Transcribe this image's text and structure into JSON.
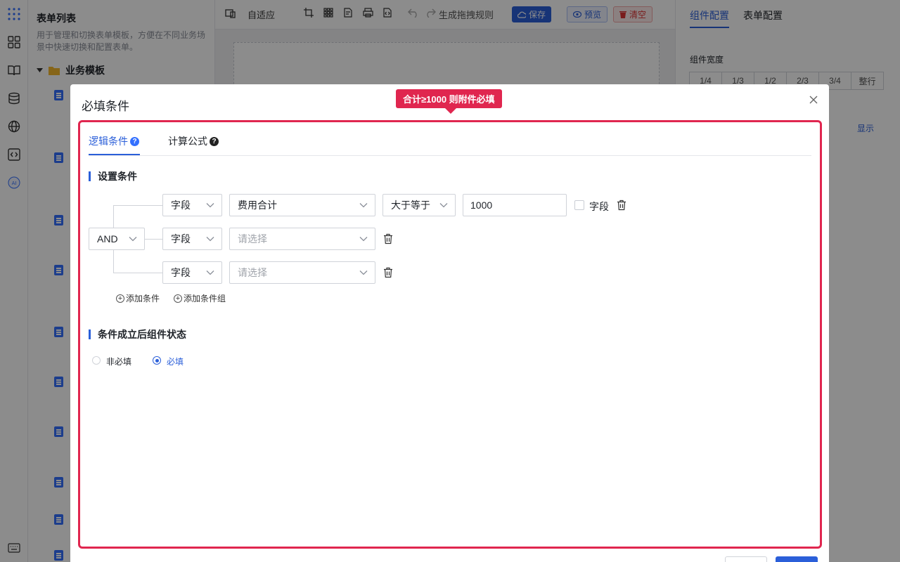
{
  "sidebar": {
    "title": "表单列表",
    "description": "用于管理和切换表单模板，方便在不同业务场景中快速切换和配置表单。",
    "folder": "业务模板"
  },
  "toolbar": {
    "adaptive": "自适应",
    "generate_rule": "生成拖拽规则",
    "save": "保存",
    "preview": "预览",
    "clear": "清空"
  },
  "right_panel": {
    "tab_component": "组件配置",
    "tab_form": "表单配置",
    "width_label": "组件宽度",
    "width_options": [
      "1/4",
      "1/3",
      "1/2",
      "2/3",
      "3/4",
      "整行"
    ],
    "show_label": "显示"
  },
  "callout": "合计≥1000 则附件必填",
  "modal": {
    "title": "必填条件",
    "tabs": {
      "logic": "逻辑条件",
      "formula": "计算公式"
    },
    "section_conditions": "设置条件",
    "logic_operator": "AND",
    "rows": [
      {
        "type": "字段",
        "field": "费用合计",
        "operator": "大于等于",
        "value": "1000",
        "checkbox_label": "字段"
      },
      {
        "type": "字段",
        "field_placeholder": "请选择"
      },
      {
        "type": "字段",
        "field_placeholder": "请选择"
      }
    ],
    "add_condition": "添加条件",
    "add_condition_group": "添加条件组",
    "section_state": "条件成立后组件状态",
    "state_options": {
      "not_required": "非必填",
      "required": "必填"
    },
    "selected_state": "required"
  },
  "colors": {
    "accent": "#2b5fd9",
    "highlight": "#e0264f"
  }
}
